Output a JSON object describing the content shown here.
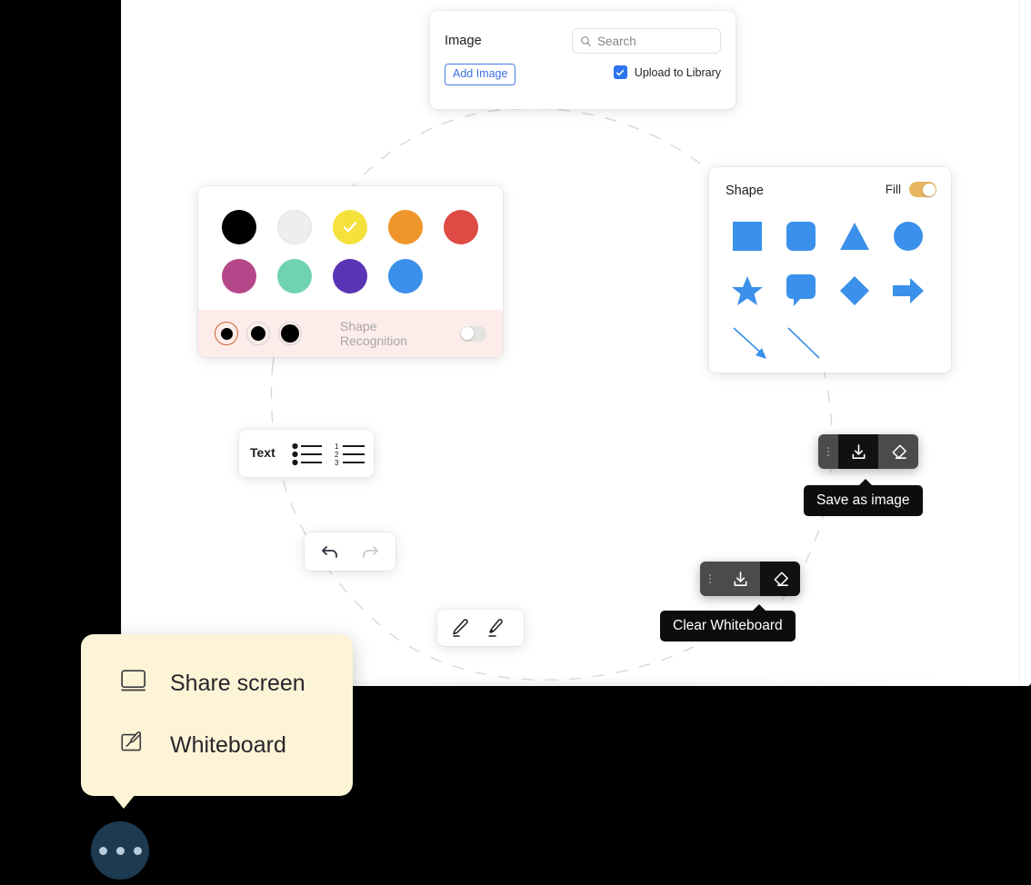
{
  "image_panel": {
    "title": "Image",
    "search_placeholder": "Search",
    "search_value": "",
    "search_icon": "search-icon",
    "add_image_label": "Add Image",
    "upload_label": "Upload to Library",
    "upload_checked": true,
    "accent_color": "#3c6fe0"
  },
  "color_panel": {
    "swatches_row1": [
      {
        "name": "black",
        "color": "#000000",
        "selected": false
      },
      {
        "name": "white",
        "color": "#eeeeee",
        "selected": false
      },
      {
        "name": "yellow",
        "color": "#f5e13c",
        "selected": true
      },
      {
        "name": "orange",
        "color": "#ef962a",
        "selected": false
      },
      {
        "name": "red",
        "color": "#dd4b44",
        "selected": false
      }
    ],
    "swatches_row2": [
      {
        "name": "magenta",
        "color": "#b4478a",
        "selected": false
      },
      {
        "name": "mint",
        "color": "#6fd3b0",
        "selected": false
      },
      {
        "name": "purple",
        "color": "#5b33b5",
        "selected": false
      },
      {
        "name": "blue",
        "color": "#3a90ea",
        "selected": false
      }
    ],
    "stroke_widths": [
      {
        "name": "thin",
        "dot": 13,
        "selected": true
      },
      {
        "name": "medium",
        "dot": 16,
        "selected": false
      },
      {
        "name": "thick",
        "dot": 20,
        "selected": false
      }
    ],
    "stroke_strip_bg": "#fcecea",
    "selected_ring_color": "#c8622d",
    "shape_recognition_label": "Shape Recognition",
    "shape_recognition_on": false
  },
  "shape_panel": {
    "title": "Shape",
    "fill_label": "Fill",
    "fill_on": true,
    "fill_toggle_color": "#e6b661",
    "shape_color": "#3a90ea",
    "shapes": [
      "square-icon",
      "rounded-square-icon",
      "triangle-icon",
      "circle-icon",
      "star-icon",
      "speech-bubble-icon",
      "diamond-icon",
      "arrow-right-icon",
      "arrow-diagonal-icon",
      "line-icon"
    ]
  },
  "text_panel": {
    "label": "Text",
    "bullet_list_icon": "bullet-list-icon",
    "numbered_list_icon": "numbered-list-icon",
    "numbers": [
      "1",
      "2",
      "3"
    ]
  },
  "history_panel": {
    "undo_icon": "undo-icon",
    "redo_icon": "redo-icon",
    "undo_enabled": true,
    "redo_enabled": false
  },
  "pen_panel": {
    "pen_icon": "pen-icon",
    "highlighter_icon": "highlighter-icon"
  },
  "toolbar_save": {
    "handle_icon": "drag-handle-icon",
    "download_icon": "download-icon",
    "eraser_icon": "eraser-icon",
    "active": "download",
    "tooltip": "Save as image"
  },
  "toolbar_clear": {
    "handle_icon": "drag-handle-icon",
    "download_icon": "download-icon",
    "eraser_icon": "eraser-icon",
    "active": "eraser",
    "tooltip": "Clear Whiteboard"
  },
  "more_menu": {
    "background": "#fdf4d7",
    "items": [
      {
        "label": "Share screen",
        "icon": "monitor-icon"
      },
      {
        "label": "Whiteboard",
        "icon": "whiteboard-pen-icon"
      }
    ]
  },
  "fab": {
    "name": "more-options-button",
    "icon": "ellipsis-icon",
    "color": "#1d3a50"
  }
}
